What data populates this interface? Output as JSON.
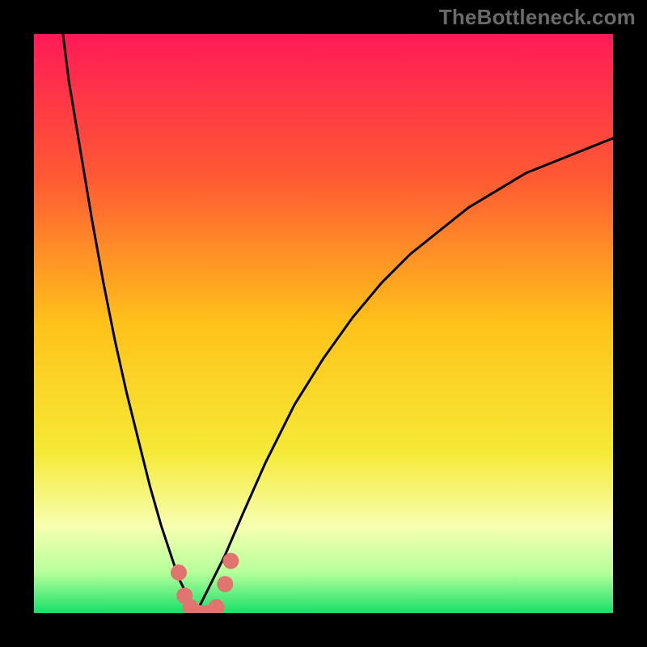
{
  "watermark": "TheBottleneck.com",
  "chart_data": {
    "type": "line",
    "title": "",
    "xlabel": "",
    "ylabel": "",
    "xlim": [
      0,
      100
    ],
    "ylim": [
      0,
      100
    ],
    "grid": false,
    "legend": false,
    "background_gradient": {
      "stops": [
        {
          "pos": 0.0,
          "color": "#ff1a57"
        },
        {
          "pos": 0.25,
          "color": "#ff5a33"
        },
        {
          "pos": 0.5,
          "color": "#ffc21a"
        },
        {
          "pos": 0.72,
          "color": "#f5e935"
        },
        {
          "pos": 0.85,
          "color": "#f7ffb0"
        },
        {
          "pos": 0.93,
          "color": "#b6ff9a"
        },
        {
          "pos": 1.0,
          "color": "#18e06a"
        }
      ]
    },
    "series": [
      {
        "name": "left-branch",
        "x": [
          5,
          6,
          8,
          10,
          12,
          14,
          16,
          18,
          20,
          22,
          24,
          25,
          26,
          27,
          28
        ],
        "values": [
          100,
          92,
          80,
          68,
          57,
          47,
          38,
          30,
          22,
          15,
          9,
          6,
          4,
          2,
          0
        ]
      },
      {
        "name": "right-branch",
        "x": [
          28,
          30,
          33,
          36,
          40,
          45,
          50,
          55,
          60,
          65,
          70,
          75,
          80,
          85,
          90,
          95,
          100
        ],
        "values": [
          0,
          4,
          10,
          17,
          26,
          36,
          44,
          51,
          57,
          62,
          66,
          70,
          73,
          76,
          78,
          80,
          82
        ]
      }
    ],
    "highlight_points": {
      "series": "combined",
      "color": "#e0746e",
      "points": [
        {
          "x": 25,
          "y": 7
        },
        {
          "x": 26,
          "y": 3
        },
        {
          "x": 27,
          "y": 1
        },
        {
          "x": 28.5,
          "y": 0
        },
        {
          "x": 30,
          "y": 0
        },
        {
          "x": 31.5,
          "y": 1
        },
        {
          "x": 33,
          "y": 5
        },
        {
          "x": 34,
          "y": 9
        }
      ]
    }
  },
  "plot_geometry": {
    "inner_left": 42,
    "inner_top": 42,
    "inner_width": 716,
    "inner_height": 716
  }
}
